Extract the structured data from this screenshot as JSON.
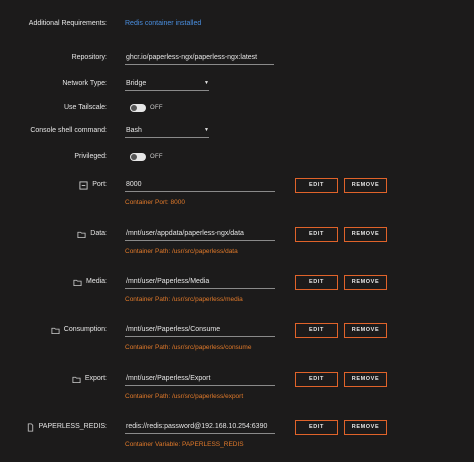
{
  "additional_requirements": {
    "label": "Additional Requirements:",
    "value": "Redis container installed"
  },
  "repository": {
    "label": "Repository:",
    "value": "ghcr.io/paperless-ngx/paperless-ngx:latest"
  },
  "network_type": {
    "label": "Network Type:",
    "value": "Bridge",
    "caret": "▼"
  },
  "use_tailscale": {
    "label": "Use Tailscale:",
    "state": "OFF"
  },
  "console_shell": {
    "label": "Console shell command:",
    "value": "Bash",
    "caret": "▼"
  },
  "privileged": {
    "label": "Privileged:",
    "state": "OFF"
  },
  "buttons": {
    "edit": "EDIT",
    "remove": "REMOVE"
  },
  "mappings": [
    {
      "label": "Port:",
      "icon": "minus-square-icon",
      "value": "8000",
      "hint": "Container Port: 8000"
    },
    {
      "label": "Data:",
      "icon": "folder-icon",
      "value": "/mnt/user/appdata/paperless-ngx/data",
      "hint": "Container Path: /usr/src/paperless/data"
    },
    {
      "label": "Media:",
      "icon": "folder-icon",
      "value": "/mnt/user/Paperless/Media",
      "hint": "Container Path: /usr/src/paperless/media"
    },
    {
      "label": "Consumption:",
      "icon": "folder-icon",
      "value": "/mnt/user/Paperless/Consume",
      "hint": "Container Path: /usr/src/paperless/consume"
    },
    {
      "label": "Export:",
      "icon": "folder-icon",
      "value": "/mnt/user/Paperless/Export",
      "hint": "Container Path: /usr/src/paperless/export"
    },
    {
      "label": "PAPERLESS_REDIS:",
      "icon": "file-icon",
      "value": "redis://redis:password@192.168.10.254:6390",
      "hint": "Container Variable: PAPERLESS_REDIS"
    }
  ]
}
